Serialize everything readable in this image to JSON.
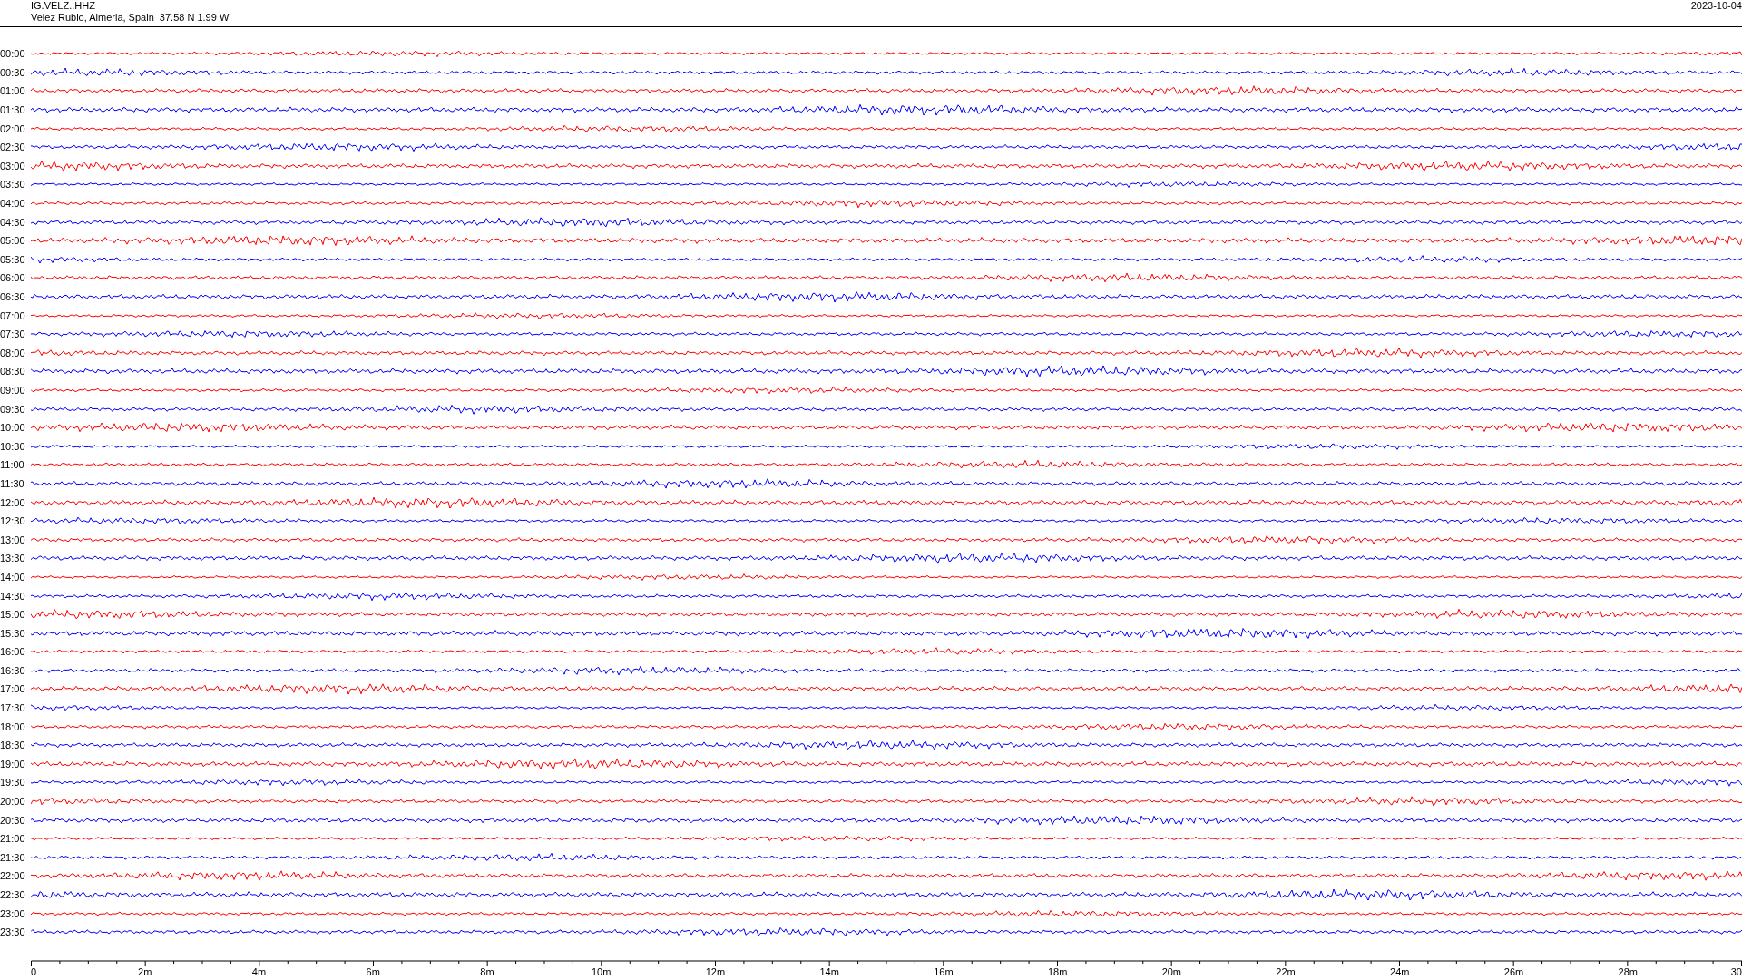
{
  "header": {
    "station": "IG.VELZ..HHZ",
    "location": "Velez Rubio, Almeria, Spain  37.58 N 1.99 W",
    "date": "2023-10-04"
  },
  "rows": [
    {
      "label": "00:00",
      "color": "#ff0000"
    },
    {
      "label": "00:30",
      "color": "#0000ff"
    },
    {
      "label": "01:00",
      "color": "#ff0000"
    },
    {
      "label": "01:30",
      "color": "#0000ff"
    },
    {
      "label": "02:00",
      "color": "#ff0000"
    },
    {
      "label": "02:30",
      "color": "#0000ff"
    },
    {
      "label": "03:00",
      "color": "#ff0000"
    },
    {
      "label": "03:30",
      "color": "#0000ff"
    },
    {
      "label": "04:00",
      "color": "#ff0000"
    },
    {
      "label": "04:30",
      "color": "#0000ff"
    },
    {
      "label": "05:00",
      "color": "#ff0000"
    },
    {
      "label": "05:30",
      "color": "#0000ff"
    },
    {
      "label": "06:00",
      "color": "#ff0000"
    },
    {
      "label": "06:30",
      "color": "#0000ff"
    },
    {
      "label": "07:00",
      "color": "#ff0000"
    },
    {
      "label": "07:30",
      "color": "#0000ff"
    },
    {
      "label": "08:00",
      "color": "#ff0000"
    },
    {
      "label": "08:30",
      "color": "#0000ff"
    },
    {
      "label": "09:00",
      "color": "#ff0000"
    },
    {
      "label": "09:30",
      "color": "#0000ff"
    },
    {
      "label": "10:00",
      "color": "#ff0000"
    },
    {
      "label": "10:30",
      "color": "#0000ff"
    },
    {
      "label": "11:00",
      "color": "#ff0000"
    },
    {
      "label": "11:30",
      "color": "#0000ff"
    },
    {
      "label": "12:00",
      "color": "#ff0000"
    },
    {
      "label": "12:30",
      "color": "#0000ff"
    },
    {
      "label": "13:00",
      "color": "#ff0000"
    },
    {
      "label": "13:30",
      "color": "#0000ff"
    },
    {
      "label": "14:00",
      "color": "#ff0000"
    },
    {
      "label": "14:30",
      "color": "#0000ff"
    },
    {
      "label": "15:00",
      "color": "#ff0000"
    },
    {
      "label": "15:30",
      "color": "#0000ff"
    },
    {
      "label": "16:00",
      "color": "#ff0000"
    },
    {
      "label": "16:30",
      "color": "#0000ff"
    },
    {
      "label": "17:00",
      "color": "#ff0000"
    },
    {
      "label": "17:30",
      "color": "#0000ff"
    },
    {
      "label": "18:00",
      "color": "#ff0000"
    },
    {
      "label": "18:30",
      "color": "#0000ff"
    },
    {
      "label": "19:00",
      "color": "#ff0000"
    },
    {
      "label": "19:30",
      "color": "#0000ff"
    },
    {
      "label": "20:00",
      "color": "#ff0000"
    },
    {
      "label": "20:30",
      "color": "#0000ff"
    },
    {
      "label": "21:00",
      "color": "#ff0000"
    },
    {
      "label": "21:30",
      "color": "#0000ff"
    },
    {
      "label": "22:00",
      "color": "#ff0000"
    },
    {
      "label": "22:30",
      "color": "#0000ff"
    },
    {
      "label": "23:00",
      "color": "#ff0000"
    },
    {
      "label": "23:30",
      "color": "#0000ff"
    }
  ],
  "axis": {
    "ticks": [
      "0",
      "2m",
      "4m",
      "6m",
      "8m",
      "10m",
      "12m",
      "14m",
      "16m",
      "18m",
      "20m",
      "22m",
      "24m",
      "26m",
      "28m",
      "30"
    ]
  }
}
